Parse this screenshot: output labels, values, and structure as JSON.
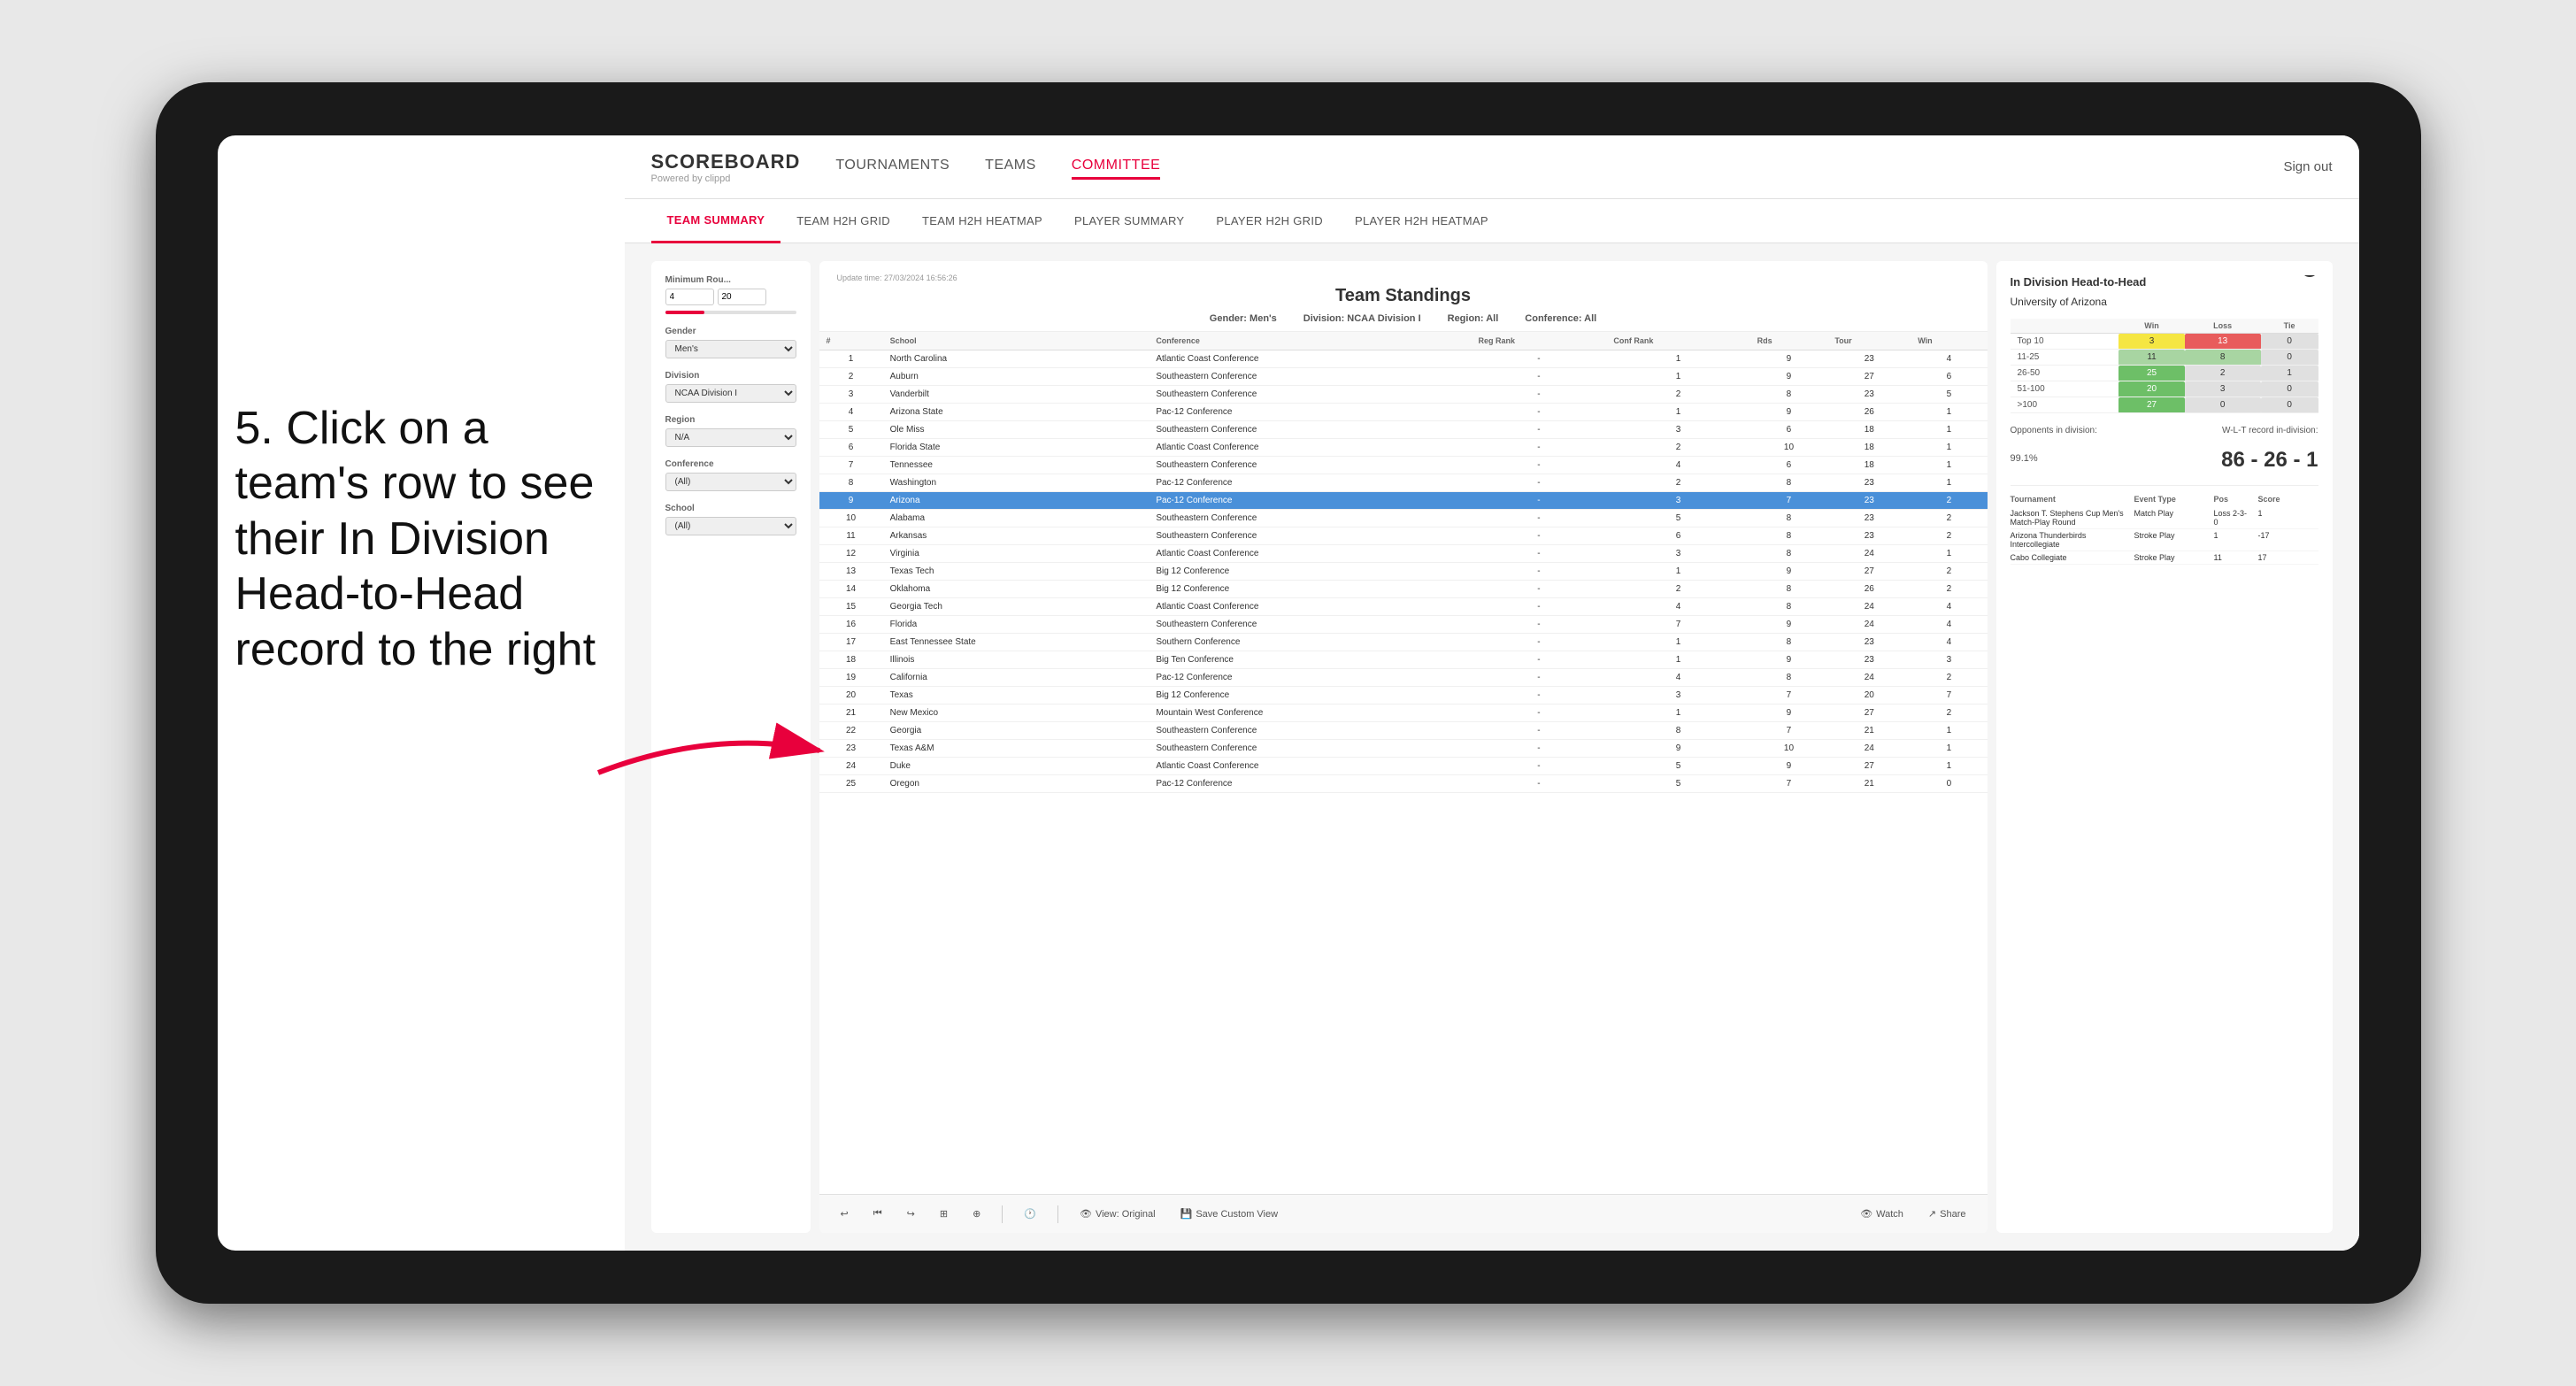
{
  "page": {
    "background": "#e8e8e8"
  },
  "annotation": {
    "text": "5. Click on a team's row to see their In Division Head-to-Head record to the right"
  },
  "nav": {
    "logo": "SCOREBOARD",
    "logo_sub": "Powered by clippd",
    "items": [
      "TOURNAMENTS",
      "TEAMS",
      "COMMITTEE"
    ],
    "active_item": "COMMITTEE",
    "sign_out": "Sign out"
  },
  "sub_nav": {
    "items": [
      "TEAM SUMMARY",
      "TEAM H2H GRID",
      "TEAM H2H HEATMAP",
      "PLAYER SUMMARY",
      "PLAYER H2H GRID",
      "PLAYER H2H HEATMAP"
    ],
    "active_item": "PLAYER SUMMARY"
  },
  "standings": {
    "title": "Team Standings",
    "update_time": "Update time:",
    "update_date": "27/03/2024 16:56:26",
    "gender_label": "Gender:",
    "gender_value": "Men's",
    "division_label": "Division:",
    "division_value": "NCAA Division I",
    "region_label": "Region:",
    "region_value": "All",
    "conference_label": "Conference:",
    "conference_value": "All"
  },
  "filters": {
    "min_rounds_label": "Minimum Rou...",
    "min_rounds_val1": "4",
    "min_rounds_val2": "20",
    "gender_label": "Gender",
    "gender_value": "Men's",
    "division_label": "Division",
    "division_value": "NCAA Division I",
    "region_label": "Region",
    "region_value": "N/A",
    "conference_label": "Conference",
    "conference_value": "(All)",
    "school_label": "School",
    "school_value": "(All)"
  },
  "table": {
    "headers": [
      "#",
      "School",
      "Conference",
      "Reg Rank",
      "Conf Rank",
      "Rds",
      "Tour",
      "Win"
    ],
    "rows": [
      {
        "num": 1,
        "school": "North Carolina",
        "conf": "Atlantic Coast Conference",
        "reg": "-",
        "crank": 1,
        "rds": 9,
        "tour": 23,
        "win": 4
      },
      {
        "num": 2,
        "school": "Auburn",
        "conf": "Southeastern Conference",
        "reg": "-",
        "crank": 1,
        "rds": 9,
        "tour": 27,
        "win": 6
      },
      {
        "num": 3,
        "school": "Vanderbilt",
        "conf": "Southeastern Conference",
        "reg": "-",
        "crank": 2,
        "rds": 8,
        "tour": 23,
        "win": 5
      },
      {
        "num": 4,
        "school": "Arizona State",
        "conf": "Pac-12 Conference",
        "reg": "-",
        "crank": 1,
        "rds": 9,
        "tour": 26,
        "win": 1
      },
      {
        "num": 5,
        "school": "Ole Miss",
        "conf": "Southeastern Conference",
        "reg": "-",
        "crank": 3,
        "rds": 6,
        "tour": 18,
        "win": 1
      },
      {
        "num": 6,
        "school": "Florida State",
        "conf": "Atlantic Coast Conference",
        "reg": "-",
        "crank": 2,
        "rds": 10,
        "tour": 18,
        "win": 1
      },
      {
        "num": 7,
        "school": "Tennessee",
        "conf": "Southeastern Conference",
        "reg": "-",
        "crank": 4,
        "rds": 6,
        "tour": 18,
        "win": 1
      },
      {
        "num": 8,
        "school": "Washington",
        "conf": "Pac-12 Conference",
        "reg": "-",
        "crank": 2,
        "rds": 8,
        "tour": 23,
        "win": 1
      },
      {
        "num": 9,
        "school": "Arizona",
        "conf": "Pac-12 Conference",
        "reg": "-",
        "crank": 3,
        "rds": 7,
        "tour": 23,
        "win": 2,
        "highlighted": true
      },
      {
        "num": 10,
        "school": "Alabama",
        "conf": "Southeastern Conference",
        "reg": "-",
        "crank": 5,
        "rds": 8,
        "tour": 23,
        "win": 2
      },
      {
        "num": 11,
        "school": "Arkansas",
        "conf": "Southeastern Conference",
        "reg": "-",
        "crank": 6,
        "rds": 8,
        "tour": 23,
        "win": 2
      },
      {
        "num": 12,
        "school": "Virginia",
        "conf": "Atlantic Coast Conference",
        "reg": "-",
        "crank": 3,
        "rds": 8,
        "tour": 24,
        "win": 1
      },
      {
        "num": 13,
        "school": "Texas Tech",
        "conf": "Big 12 Conference",
        "reg": "-",
        "crank": 1,
        "rds": 9,
        "tour": 27,
        "win": 2
      },
      {
        "num": 14,
        "school": "Oklahoma",
        "conf": "Big 12 Conference",
        "reg": "-",
        "crank": 2,
        "rds": 8,
        "tour": 26,
        "win": 2
      },
      {
        "num": 15,
        "school": "Georgia Tech",
        "conf": "Atlantic Coast Conference",
        "reg": "-",
        "crank": 4,
        "rds": 8,
        "tour": 24,
        "win": 4
      },
      {
        "num": 16,
        "school": "Florida",
        "conf": "Southeastern Conference",
        "reg": "-",
        "crank": 7,
        "rds": 9,
        "tour": 24,
        "win": 4
      },
      {
        "num": 17,
        "school": "East Tennessee State",
        "conf": "Southern Conference",
        "reg": "-",
        "crank": 1,
        "rds": 8,
        "tour": 23,
        "win": 4
      },
      {
        "num": 18,
        "school": "Illinois",
        "conf": "Big Ten Conference",
        "reg": "-",
        "crank": 1,
        "rds": 9,
        "tour": 23,
        "win": 3
      },
      {
        "num": 19,
        "school": "California",
        "conf": "Pac-12 Conference",
        "reg": "-",
        "crank": 4,
        "rds": 8,
        "tour": 24,
        "win": 2
      },
      {
        "num": 20,
        "school": "Texas",
        "conf": "Big 12 Conference",
        "reg": "-",
        "crank": 3,
        "rds": 7,
        "tour": 20,
        "win": 7
      },
      {
        "num": 21,
        "school": "New Mexico",
        "conf": "Mountain West Conference",
        "reg": "-",
        "crank": 1,
        "rds": 9,
        "tour": 27,
        "win": 2
      },
      {
        "num": 22,
        "school": "Georgia",
        "conf": "Southeastern Conference",
        "reg": "-",
        "crank": 8,
        "rds": 7,
        "tour": 21,
        "win": 1
      },
      {
        "num": 23,
        "school": "Texas A&M",
        "conf": "Southeastern Conference",
        "reg": "-",
        "crank": 9,
        "rds": 10,
        "tour": 24,
        "win": 1
      },
      {
        "num": 24,
        "school": "Duke",
        "conf": "Atlantic Coast Conference",
        "reg": "-",
        "crank": 5,
        "rds": 9,
        "tour": 27,
        "win": 1
      },
      {
        "num": 25,
        "school": "Oregon",
        "conf": "Pac-12 Conference",
        "reg": "-",
        "crank": 5,
        "rds": 7,
        "tour": 21,
        "win": 0
      }
    ]
  },
  "h2h_panel": {
    "title": "In Division Head-to-Head",
    "team": "University of Arizona",
    "win_label": "Win",
    "loss_label": "Loss",
    "tie_label": "Tie",
    "rows": [
      {
        "label": "Top 10",
        "win": 3,
        "loss": 13,
        "tie": 0,
        "win_color": "yellow",
        "loss_color": "red"
      },
      {
        "label": "11-25",
        "win": 11,
        "loss": 8,
        "tie": 0,
        "win_color": "green",
        "loss_color": "lightgreen"
      },
      {
        "label": "26-50",
        "win": 25,
        "loss": 2,
        "tie": 1,
        "win_color": "green",
        "loss_color": "gray"
      },
      {
        "label": "51-100",
        "win": 20,
        "loss": 3,
        "tie": 0,
        "win_color": "green",
        "loss_color": "gray"
      },
      {
        "label": ">100",
        "win": 27,
        "loss": 0,
        "tie": 0,
        "win_color": "green",
        "loss_color": "gray"
      }
    ],
    "opponents_label": "Opponents in division:",
    "opponents_pct": "99.1%",
    "wlt_label": "W-L-T record in-division:",
    "record": "86 - 26 - 1",
    "tournaments": [
      {
        "name": "Jackson T. Stephens Cup Men's Match-Play Round",
        "type": "Match Play",
        "result": "Loss",
        "pos": "2-3-0",
        "score": "1"
      },
      {
        "name": "Arizona Thunderbirds Intercollegiate",
        "type": "Stroke Play",
        "result": "",
        "pos": "1",
        "score": "-17"
      },
      {
        "name": "Cabo Collegiate",
        "type": "Stroke Play",
        "result": "",
        "pos": "11",
        "score": "17"
      }
    ]
  },
  "toolbar": {
    "undo": "↩",
    "redo": "↪",
    "view_original": "View: Original",
    "save_custom": "Save Custom View",
    "watch": "Watch",
    "share": "Share"
  }
}
